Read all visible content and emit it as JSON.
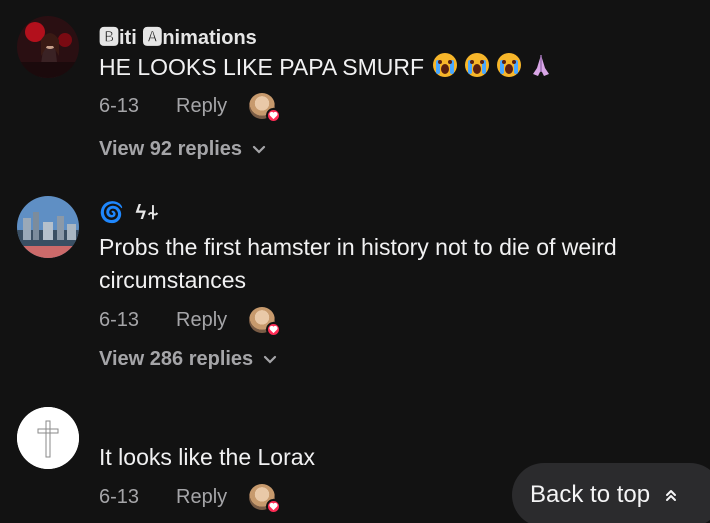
{
  "comments": [
    {
      "author": "🅱iti 🅰nimations",
      "text": "HE LOOKS LIKE PAPA SMURF",
      "emojis": [
        "crying-face-emoji",
        "crying-face-emoji",
        "crying-face-emoji",
        "folded-hands-emoji"
      ],
      "date": "6-13",
      "reply_label": "Reply",
      "view_replies": "View 92 replies"
    },
    {
      "author": "🌀 ϟ⍭",
      "text": "Probs the first hamster in history not to die of weird circumstances",
      "date": "6-13",
      "reply_label": "Reply",
      "view_replies": "View 286 replies"
    },
    {
      "author": "",
      "text": "It looks like the Lorax",
      "date": "6-13",
      "reply_label": "Reply"
    }
  ],
  "back_to_top": "Back to top",
  "colors": {
    "background": "#121212",
    "muted_text": "#a5a5a8",
    "heart_badge": "#fe2c55",
    "pill": "#2b2b2d"
  }
}
